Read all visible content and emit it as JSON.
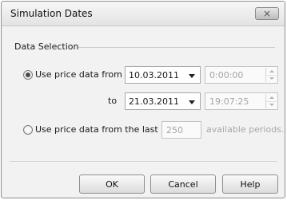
{
  "window": {
    "title": "Simulation Dates",
    "close_icon": "×"
  },
  "data_selection": {
    "label": "Data Selection",
    "option_range": {
      "label": "Use price data from",
      "selected": true,
      "from_date": "10.03.2011",
      "from_time": "0:00:00",
      "to_label": "to",
      "to_date": "21.03.2011",
      "to_time": "19:07:25"
    },
    "option_last": {
      "label": "Use price data from the last",
      "selected": false,
      "periods_value": "250",
      "suffix": "available periods."
    }
  },
  "buttons": {
    "ok": "OK",
    "cancel": "Cancel",
    "help": "Help"
  }
}
